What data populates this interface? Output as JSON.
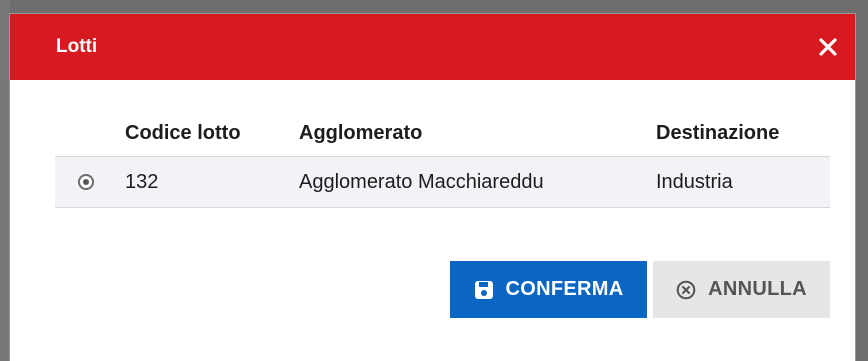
{
  "dialog": {
    "title": "Lotti",
    "close_icon": "close-icon"
  },
  "table": {
    "headers": [
      "Codice lotto",
      "Agglomerato",
      "Destinazione"
    ],
    "rows": [
      {
        "selected": true,
        "codice_lotto": "132",
        "agglomerato": "Agglomerato Macchiareddu",
        "destinazione": "Industria"
      }
    ]
  },
  "buttons": {
    "confirm_label": "CONFERMA",
    "confirm_icon": "save-icon",
    "cancel_label": "ANNULLA",
    "cancel_icon": "cancel-circle-icon"
  },
  "colors": {
    "header": "#d71920",
    "confirm": "#0a66c2",
    "cancel": "#e6e6e6",
    "row_bg": "#f1f3f7"
  }
}
